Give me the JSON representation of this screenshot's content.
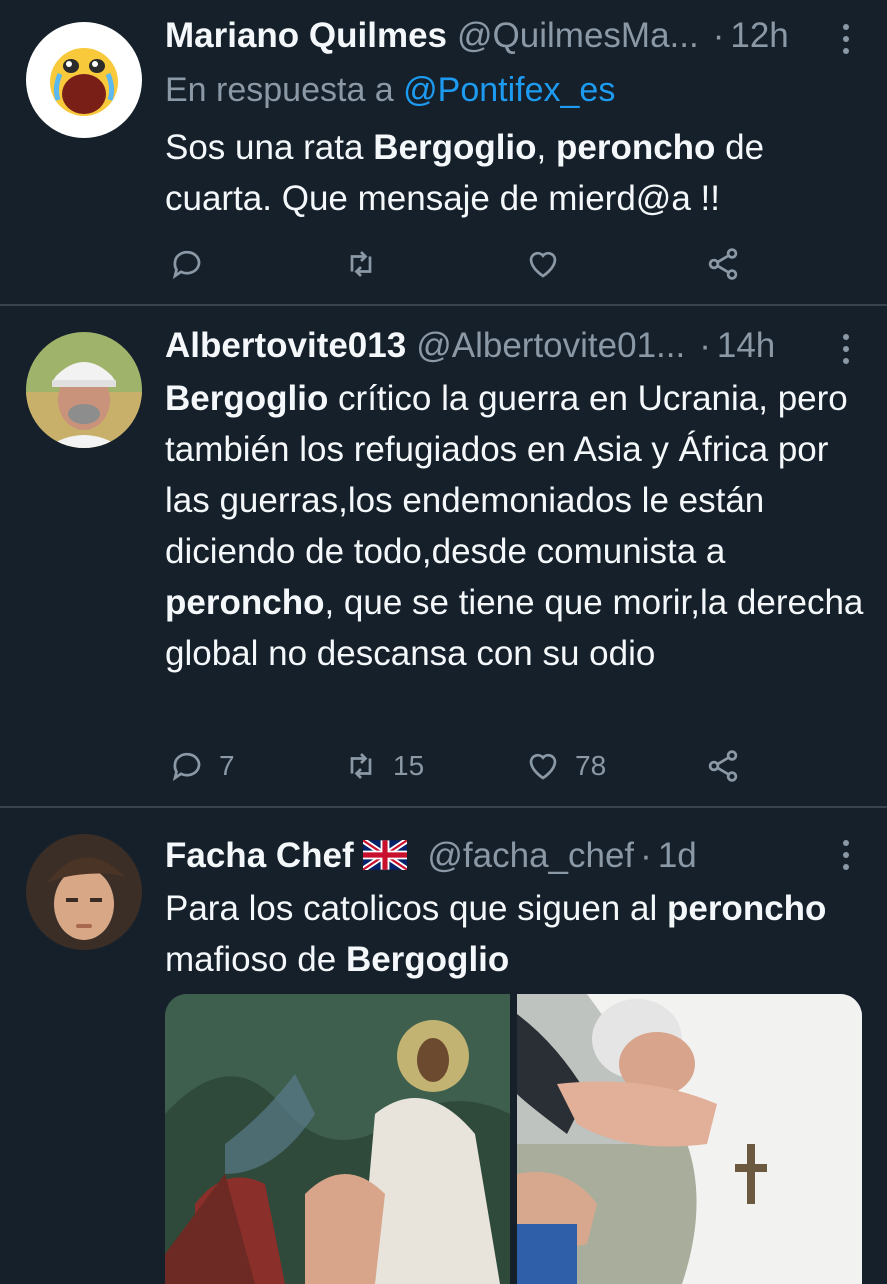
{
  "tweets": [
    {
      "name": "Mariano Quilmes",
      "handle": "@QuilmesMa...",
      "time": "12h",
      "reply_prefix": "En respuesta a",
      "reply_mention": "@Pontifex_es",
      "text_parts": [
        "Sos una rata ",
        "Bergoglio",
        ", ",
        "peroncho",
        " de cuarta. Que mensaje de mierd@a !!"
      ],
      "counts": {
        "reply": "",
        "retweet": "",
        "like": ""
      }
    },
    {
      "name": "Albertovite013",
      "handle": "@Albertovite01...",
      "time": "14h",
      "text_parts": [
        "Bergoglio",
        " crítico la guerra en Ucrania, pero también los refugiados en Asia y África por las guerras,los endemoniados le están diciendo de todo,desde comunista a ",
        "peroncho",
        ", que se tiene que morir,la derecha global no descansa con su odio"
      ],
      "counts": {
        "reply": "7",
        "retweet": "15",
        "like": "78"
      }
    },
    {
      "name": "Facha Chef",
      "handle": "@facha_chef",
      "time": "1d",
      "text_parts": [
        "Para los catolicos que siguen al ",
        "peroncho",
        " mafioso de ",
        "Bergoglio"
      ],
      "counts": {
        "reply": "",
        "retweet": "",
        "like": ""
      }
    }
  ],
  "icons": [
    "reply-icon",
    "retweet-icon",
    "like-icon",
    "share-icon",
    "more-icon",
    "uk-flag-icon"
  ],
  "colors": {
    "background": "#15202b",
    "text": "#f5f8fa",
    "secondary": "#8b98a5",
    "link": "#1d9bf0",
    "divider": "#38444d"
  }
}
